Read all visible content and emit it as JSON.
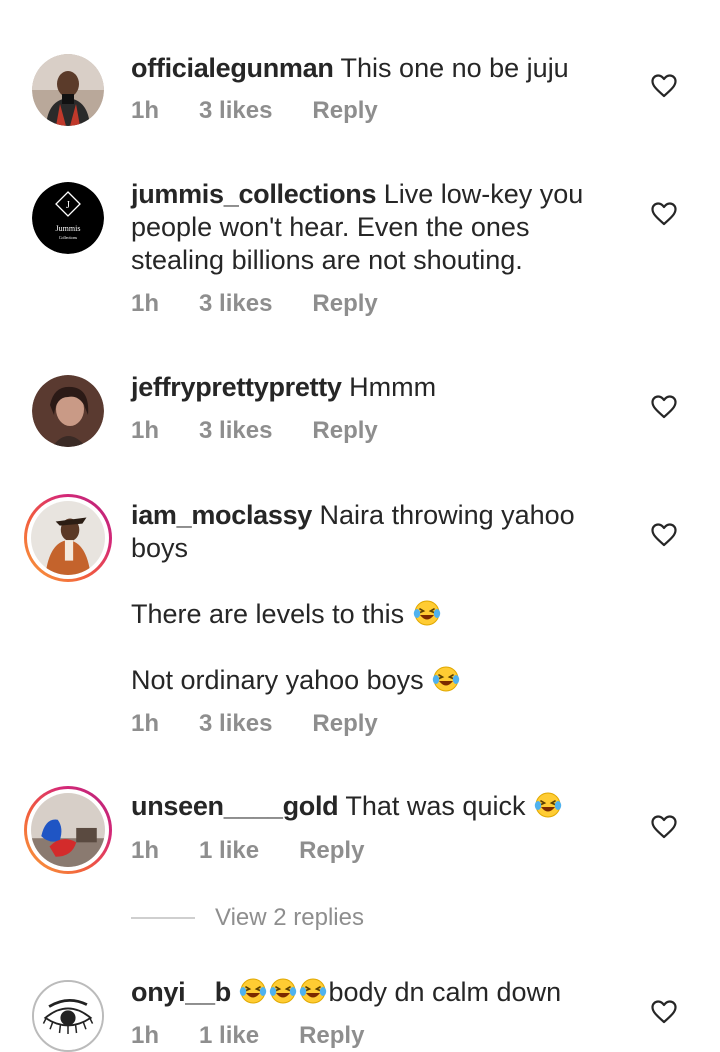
{
  "comments": [
    {
      "username": "officialegunman",
      "text": "This one no be juju",
      "time": "1h",
      "likes": "3 likes",
      "reply": "Reply"
    },
    {
      "username": "jummis_collections",
      "text": "Live low-key you people won't hear. Even the ones stealing billions are not shouting.",
      "time": "1h",
      "likes": "3 likes",
      "reply": "Reply",
      "avatar_brand": "Jummis",
      "avatar_sub": "Collections"
    },
    {
      "username": "jeffryprettypretty",
      "text": "Hmmm",
      "time": "1h",
      "likes": "3 likes",
      "reply": "Reply"
    },
    {
      "username": "iam_moclassy",
      "text": "Naira throwing yahoo boys",
      "para1": "There are levels to this",
      "para2": "Not ordinary yahoo boys",
      "time": "1h",
      "likes": "3 likes",
      "reply": "Reply"
    },
    {
      "username": "unseen____gold",
      "text": "That was quick",
      "time": "1h",
      "likes": "1 like",
      "reply": "Reply"
    },
    {
      "username": "onyi__b",
      "text": "body dn calm down",
      "time": "1h",
      "likes": "1 like",
      "reply": "Reply"
    }
  ],
  "view_replies": "View 2 replies",
  "icons": {
    "like": "heart-outline-icon",
    "emoji": "face-with-tears-of-joy-emoji"
  },
  "colors": {
    "text": "#262626",
    "meta": "#8e8e8e",
    "ring_start": "#f9a13a",
    "ring_end": "#b3237d"
  }
}
